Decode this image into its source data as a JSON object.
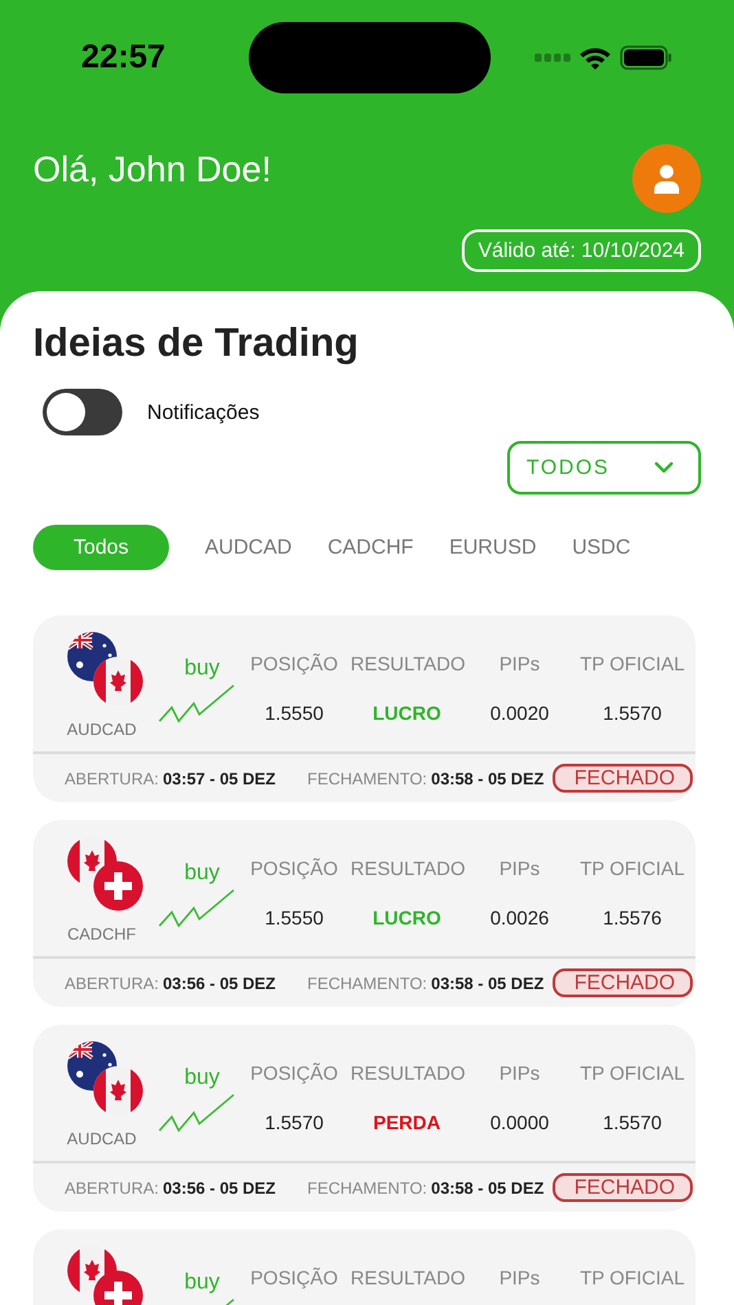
{
  "status_bar": {
    "time": "22:57"
  },
  "header": {
    "greeting": "Olá, John Doe!",
    "validity": "Válido até: 10/10/2024"
  },
  "title": "Ideias de Trading",
  "notifications": {
    "label": "Notificações",
    "on": false
  },
  "dropdown": {
    "value": "TODOS"
  },
  "filters": [
    {
      "label": "Todos",
      "selected": true
    },
    {
      "label": "AUDCAD",
      "selected": false
    },
    {
      "label": "CADCHF",
      "selected": false
    },
    {
      "label": "EURUSD",
      "selected": false
    },
    {
      "label": "USDC",
      "selected": false
    }
  ],
  "trades": [
    {
      "flags": [
        {
          "kind": "au"
        },
        {
          "kind": "ca"
        }
      ],
      "pair": "AUDCAD",
      "side": "buy",
      "cells": [
        {
          "header": "POSIÇÃO",
          "value": "1.5550"
        },
        {
          "header": "RESULTADO",
          "value": "LUCRO",
          "color": "#2fb52a"
        },
        {
          "header": "PIPs",
          "value": "0.0020"
        },
        {
          "header": "TP OFICIAL",
          "value": "1.5570"
        }
      ],
      "open_label": "ABERTURA:",
      "open_time": "03:57 - 05 DEZ",
      "close_label": "FECHAMENTO:",
      "close_time": "03:58 - 05 DEZ",
      "status": "FECHADO"
    },
    {
      "flags": [
        {
          "kind": "ca"
        },
        {
          "kind": "ch"
        }
      ],
      "pair": "CADCHF",
      "side": "buy",
      "cells": [
        {
          "header": "POSIÇÃO",
          "value": "1.5550"
        },
        {
          "header": "RESULTADO",
          "value": "LUCRO",
          "color": "#2fb52a"
        },
        {
          "header": "PIPs",
          "value": "0.0026"
        },
        {
          "header": "TP OFICIAL",
          "value": "1.5576"
        }
      ],
      "open_label": "ABERTURA:",
      "open_time": "03:56 - 05 DEZ",
      "close_label": "FECHAMENTO:",
      "close_time": "03:58 - 05 DEZ",
      "status": "FECHADO"
    },
    {
      "flags": [
        {
          "kind": "au"
        },
        {
          "kind": "ca"
        }
      ],
      "pair": "AUDCAD",
      "side": "buy",
      "cells": [
        {
          "header": "POSIÇÃO",
          "value": "1.5570"
        },
        {
          "header": "RESULTADO",
          "value": "PERDA",
          "color": "#e0111b"
        },
        {
          "header": "PIPs",
          "value": "0.0000"
        },
        {
          "header": "TP OFICIAL",
          "value": "1.5570"
        }
      ],
      "open_label": "ABERTURA:",
      "open_time": "03:56 - 05 DEZ",
      "close_label": "FECHAMENTO:",
      "close_time": "03:58 - 05 DEZ",
      "status": "FECHADO"
    },
    {
      "flags": [
        {
          "kind": "ca"
        },
        {
          "kind": "ch"
        }
      ],
      "side": "buy",
      "cells": [
        {
          "header": "POSIÇÃO"
        },
        {
          "header": "RESULTADO"
        },
        {
          "header": "PIPs"
        },
        {
          "header": "TP OFICIAL"
        }
      ]
    }
  ]
}
